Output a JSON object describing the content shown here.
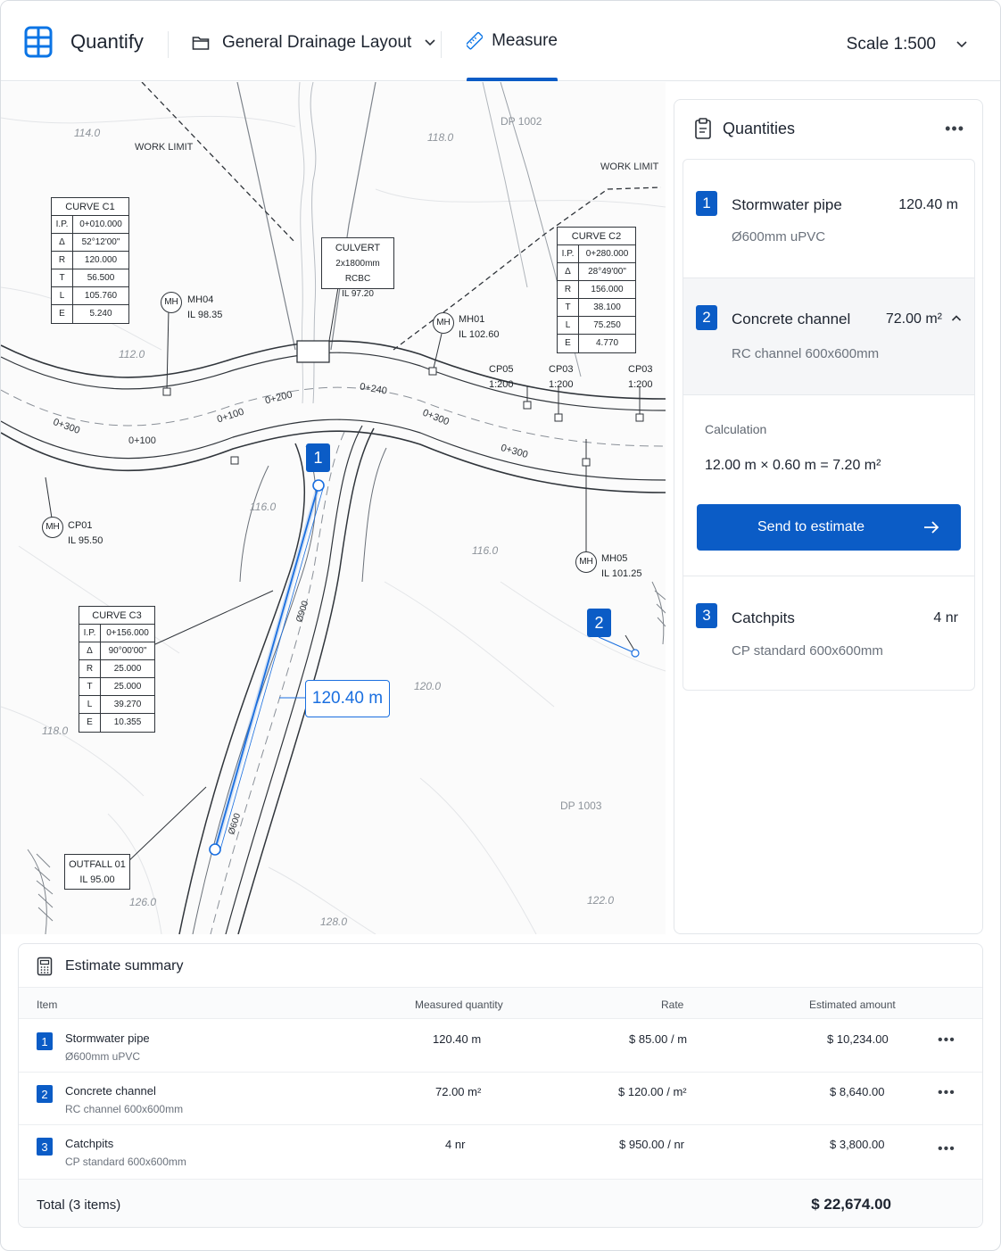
{
  "header": {
    "app_name": "Quantify",
    "document": "General Drainage Layout",
    "tab_measure": "Measure",
    "scale": "Scale 1:500"
  },
  "drawing": {
    "labels": {
      "work_limit_1": "WORK LIMIT",
      "work_limit_2": "WORK LIMIT",
      "dp1002": "DP 1002",
      "dp1003": "DP 1003",
      "contour_114": "114.0",
      "contour_118a": "118.0",
      "contour_112": "112.0",
      "contour_116a": "116.0",
      "contour_116b": "116.0",
      "contour_118b": "118.0",
      "contour_120": "120.0",
      "contour_126": "126.0",
      "contour_128": "128.0",
      "contour_122": "122.0",
      "ch_300a": "0+300",
      "ch_100a": "0+100",
      "ch_100b": "0+100",
      "ch_200": "0+200",
      "ch_240": "0+240",
      "ch_300b": "0+300",
      "ch_300c": "0+300",
      "pipe_d1": "Ø900",
      "pipe_d2": "Ø600"
    },
    "culvert": {
      "title": "CULVERT",
      "line1": "2x1800mm RCBC",
      "line2": "IL 97.20"
    },
    "curve_c1": {
      "title": "CURVE C1",
      "rows": [
        [
          "I.P.",
          "0+010.000"
        ],
        [
          "Δ",
          "52°12'00\""
        ],
        [
          "R",
          "120.000"
        ],
        [
          "T",
          "56.500"
        ],
        [
          "L",
          "105.760"
        ],
        [
          "E",
          "5.240"
        ]
      ]
    },
    "curve_c2": {
      "title": "CURVE C2",
      "rows": [
        [
          "I.P.",
          "0+280.000"
        ],
        [
          "Δ",
          "28°49'00\""
        ],
        [
          "R",
          "156.000"
        ],
        [
          "T",
          "38.100"
        ],
        [
          "L",
          "75.250"
        ],
        [
          "E",
          "4.770"
        ]
      ]
    },
    "curve_c3": {
      "title": "CURVE C3",
      "rows": [
        [
          "I.P.",
          "0+156.000"
        ],
        [
          "Δ",
          "90°00'00\""
        ],
        [
          "R",
          "25.000"
        ],
        [
          "T",
          "25.000"
        ],
        [
          "L",
          "39.270"
        ],
        [
          "E",
          "10.355"
        ]
      ]
    },
    "mh04": {
      "tag": "MH",
      "name": "MH04",
      "il": "IL 98.35"
    },
    "mh01": {
      "tag": "MH",
      "name": "MH01",
      "il": "IL 102.60"
    },
    "cp01": {
      "tag": "MH",
      "name": "CP01",
      "il": "IL 95.50"
    },
    "mh05": {
      "tag": "MH",
      "name": "MH05",
      "il": "IL 101.25"
    },
    "cp05": {
      "name": "CP05",
      "scale": "1:200"
    },
    "cp03a": {
      "name": "CP03",
      "scale": "1:200"
    },
    "cp03b": {
      "name": "CP03",
      "scale": "1:200"
    },
    "outfall": {
      "name": "OUTFALL 01",
      "il": "IL 95.00"
    },
    "marker1": "1",
    "marker2": "2",
    "measure_label": "120.40 m"
  },
  "quantities": {
    "title": "Quantities",
    "more": "•••",
    "items": [
      {
        "num": "1",
        "name": "Stormwater pipe",
        "qty": "120.40 m",
        "spec": "Ø600mm uPVC"
      },
      {
        "num": "2",
        "name": "Concrete channel",
        "qty": "72.00 m²",
        "spec": "RC channel 600x600mm"
      },
      {
        "num": "3",
        "name": "Catchpits",
        "qty": "4 nr",
        "spec": "CP standard 600x600mm"
      }
    ],
    "calc_label": "Calculation",
    "calc_value": "12.00 m × 0.60 m = 7.20 m²",
    "send_button": "Send to estimate"
  },
  "estimate": {
    "title": "Estimate summary",
    "columns": [
      "Item",
      "Measured quantity",
      "Rate",
      "Estimated amount"
    ],
    "rows": [
      {
        "num": "1",
        "name": "Stormwater pipe",
        "spec": "Ø600mm uPVC",
        "qty": "120.40 m",
        "rate": "$ 85.00 / m",
        "amount": "$ 10,234.00"
      },
      {
        "num": "2",
        "name": "Concrete channel",
        "spec": "RC channel 600x600mm",
        "qty": "72.00 m²",
        "rate": "$ 120.00 / m²",
        "amount": "$ 8,640.00"
      },
      {
        "num": "3",
        "name": "Catchpits",
        "spec": "CP standard 600x600mm",
        "qty": "4 nr",
        "rate": "$ 950.00 / nr",
        "amount": "$ 3,800.00"
      }
    ],
    "total_label": "Total (3 items)",
    "total_value": "$ 22,674.00",
    "row_more": "•••"
  }
}
